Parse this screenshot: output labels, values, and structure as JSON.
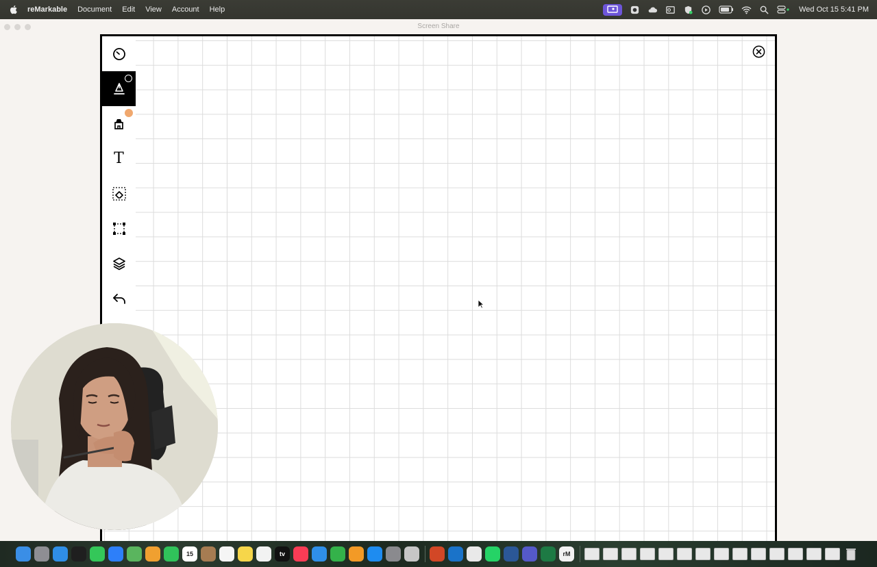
{
  "menubar": {
    "app_name": "reMarkable",
    "menus": [
      "Document",
      "Edit",
      "View",
      "Account",
      "Help"
    ],
    "clock": "Wed Oct 15  5:41 PM",
    "status_icons": [
      "screen-share-icon",
      "camera-icon",
      "cloud-icon",
      "outlook-icon",
      "vpn-icon",
      "play-icon",
      "battery-icon",
      "wifi-icon",
      "search-icon",
      "control-center-icon"
    ]
  },
  "window": {
    "title": "Screen Share"
  },
  "tablet": {
    "tools": [
      {
        "name": "menu-tool",
        "icon": "circle-menu-icon"
      },
      {
        "name": "pen-tool",
        "icon": "fountain-pen-icon",
        "active": true
      },
      {
        "name": "highlighter-tool",
        "icon": "marker-icon"
      },
      {
        "name": "text-tool",
        "icon": "text-icon",
        "glyph": "T"
      },
      {
        "name": "eraser-tool",
        "icon": "eraser-icon"
      },
      {
        "name": "selection-tool",
        "icon": "select-icon"
      },
      {
        "name": "layers-tool",
        "icon": "layers-icon"
      },
      {
        "name": "undo-tool",
        "icon": "undo-icon"
      }
    ],
    "highlighter_color": "#f0a86e",
    "template": "grid"
  },
  "dock": {
    "apps": [
      {
        "name": "finder",
        "color": "#3a8ee6"
      },
      {
        "name": "launchpad",
        "color": "#8e8e93"
      },
      {
        "name": "safari",
        "color": "#2f8ee6"
      },
      {
        "name": "chatgpt",
        "color": "#1f1f1f"
      },
      {
        "name": "messages",
        "color": "#34c759"
      },
      {
        "name": "mail",
        "color": "#2d7ff9"
      },
      {
        "name": "maps",
        "color": "#5ab55e"
      },
      {
        "name": "photos",
        "color": "#f0a030"
      },
      {
        "name": "facetime",
        "color": "#30c25a"
      },
      {
        "name": "calendar",
        "color": "#ffffff",
        "label": "15"
      },
      {
        "name": "notes-brown",
        "color": "#a67c52"
      },
      {
        "name": "reminders",
        "color": "#f5f5f5"
      },
      {
        "name": "notes",
        "color": "#f6d64a"
      },
      {
        "name": "freeform",
        "color": "#f2f2f2"
      },
      {
        "name": "apple-tv",
        "color": "#111111",
        "label": "tv"
      },
      {
        "name": "music",
        "color": "#fa3c55"
      },
      {
        "name": "keynote",
        "color": "#2f8fe8"
      },
      {
        "name": "numbers",
        "color": "#34b24a"
      },
      {
        "name": "pages",
        "color": "#f39a26"
      },
      {
        "name": "app-store",
        "color": "#1e8cf0"
      },
      {
        "name": "system-settings",
        "color": "#8a8a8e"
      },
      {
        "name": "iphone-mirroring",
        "color": "#c6c6c6"
      }
    ],
    "apps2": [
      {
        "name": "powerpoint",
        "color": "#d24726"
      },
      {
        "name": "outlook",
        "color": "#1a73c9"
      },
      {
        "name": "chrome",
        "color": "#e9e9e9"
      },
      {
        "name": "whatsapp",
        "color": "#25d366"
      },
      {
        "name": "word",
        "color": "#2b5797"
      },
      {
        "name": "teams",
        "color": "#5559c9"
      },
      {
        "name": "excel",
        "color": "#1d7a44"
      },
      {
        "name": "remarkable",
        "color": "#f2f2f2",
        "label": "rM"
      }
    ],
    "recent_files": 14
  },
  "colors": {
    "accent_purple": "#6d55d9",
    "grid_line": "#dcdcdc",
    "frame": "#000000"
  }
}
